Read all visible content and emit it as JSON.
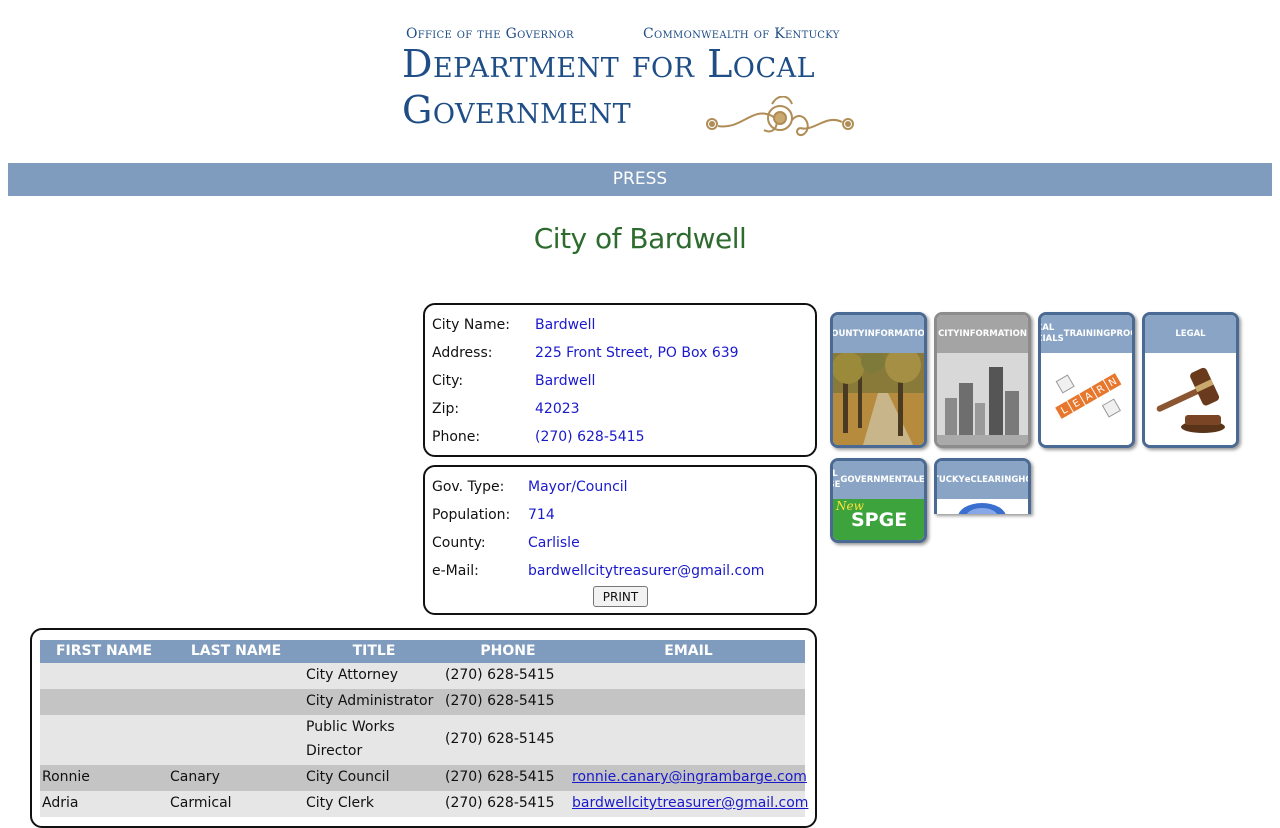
{
  "header": {
    "top_left": "Office of the Governor",
    "top_right": "Commonwealth of Kentucky",
    "line1": "Department for Local",
    "line2": "Government"
  },
  "nav": {
    "press_label": "PRESS"
  },
  "page_title": "City of Bardwell",
  "city_info": {
    "rows": [
      {
        "label": "City Name:",
        "value": "Bardwell"
      },
      {
        "label": "Address:",
        "value": "225 Front Street, PO Box 639"
      },
      {
        "label": "City:",
        "value": "Bardwell"
      },
      {
        "label": "Zip:",
        "value": "42023"
      },
      {
        "label": "Phone:",
        "value": "(270) 628-5415"
      }
    ]
  },
  "gov_info": {
    "rows": [
      {
        "label": "Gov. Type:",
        "value": "Mayor/Council"
      },
      {
        "label": "Population:",
        "value": "714"
      },
      {
        "label": "County:",
        "value": "Carlisle"
      },
      {
        "label": "e-Mail:",
        "value": "bardwellcitytreasurer@gmail.com"
      }
    ],
    "print_label": "PRINT"
  },
  "tiles": [
    {
      "caption_lines": [
        "COUNTY",
        "INFORMATION"
      ]
    },
    {
      "caption_lines": [
        "CITY",
        "INFORMATION"
      ]
    },
    {
      "caption_lines": [
        "LOCAL OFFICIALS",
        "TRAINING",
        "PROGRAM"
      ]
    },
    {
      "caption_lines": [
        "LEGAL"
      ]
    },
    {
      "caption_lines": [
        "SPECIAL PURPOSE",
        "GOVERNMENTAL",
        "ENTITIES"
      ],
      "badge": "New",
      "text": "SPGE"
    },
    {
      "caption_lines": [
        "KENTUCKY",
        "eCLEARINGHOUSE"
      ]
    }
  ],
  "learn_letters": [
    "L",
    "E",
    "A",
    "R",
    "N"
  ],
  "officials": {
    "headers": [
      "FIRST NAME",
      "LAST NAME",
      "TITLE",
      "PHONE",
      "EMAIL"
    ],
    "rows": [
      {
        "first": "",
        "last": "",
        "title": "City Attorney",
        "title2": "",
        "phone": "(270) 628-5415",
        "email": ""
      },
      {
        "first": "",
        "last": "",
        "title": "City Administrator",
        "title2": "",
        "phone": "(270) 628-5415",
        "email": ""
      },
      {
        "first": "",
        "last": "",
        "title": "Public Works",
        "title2": "Director",
        "phone": "(270) 628-5145",
        "email": ""
      },
      {
        "first": "Ronnie",
        "last": "Canary",
        "title": "City Council",
        "title2": "",
        "phone": "(270) 628-5415",
        "email": "ronnie.canary@ingrambarge.com"
      },
      {
        "first": "Adria",
        "last": "Carmical",
        "title": "City Clerk",
        "title2": "",
        "phone": "(270) 628-5415",
        "email": "bardwellcitytreasurer@gmail.com"
      }
    ]
  },
  "colors": {
    "accent": "#7f9bbd",
    "title_green": "#2e6b2e",
    "link": "#1a1acc",
    "logo_blue": "#1f4e86"
  }
}
